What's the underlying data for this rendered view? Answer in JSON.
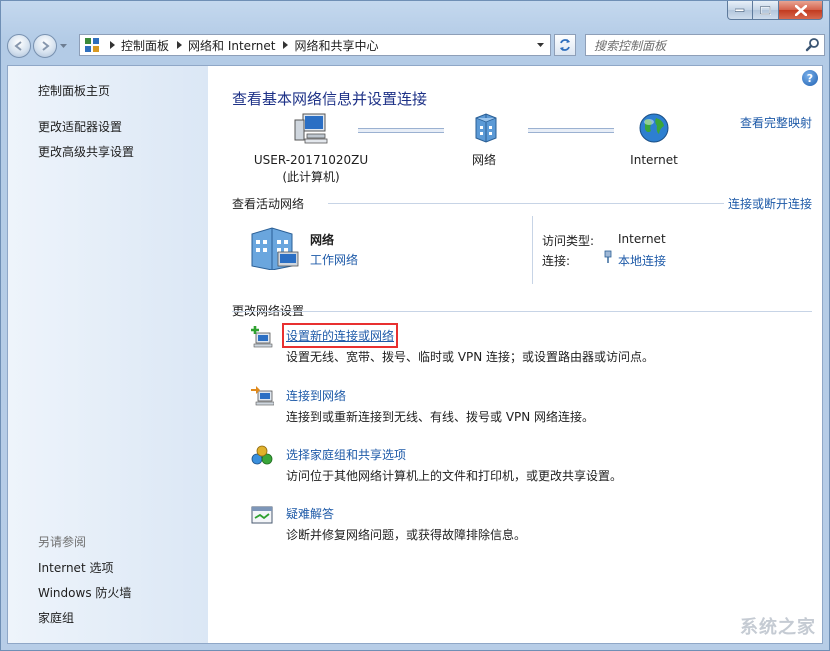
{
  "window": {
    "caption_buttons": [
      "minimize",
      "maximize",
      "close"
    ]
  },
  "navbar": {
    "breadcrumbs": [
      "控制面板",
      "网络和 Internet",
      "网络和共享中心"
    ],
    "search_placeholder": "搜索控制面板"
  },
  "sidebar": {
    "home": "控制面板主页",
    "items": [
      "更改适配器设置",
      "更改高级共享设置"
    ],
    "see_also_title": "另请参阅",
    "see_also": [
      "Internet 选项",
      "Windows 防火墙",
      "家庭组"
    ]
  },
  "main": {
    "title": "查看基本网络信息并设置连接",
    "full_map_link": "查看完整映射",
    "map": {
      "computer_name": "USER-20171020ZU",
      "computer_sub": "(此计算机)",
      "network": "网络",
      "internet": "Internet"
    },
    "active": {
      "heading": "查看活动网络",
      "connect_link": "连接或断开连接",
      "network_name": "网络",
      "network_type": "工作网络",
      "access_label": "访问类型:",
      "access_value": "Internet",
      "conn_label": "连接:",
      "conn_value": "本地连接"
    },
    "change": {
      "heading": "更改网络设置",
      "tasks": [
        {
          "link": "设置新的连接或网络",
          "desc": "设置无线、宽带、拨号、临时或 VPN 连接；或设置路由器或访问点。"
        },
        {
          "link": "连接到网络",
          "desc": "连接到或重新连接到无线、有线、拨号或 VPN 网络连接。"
        },
        {
          "link": "选择家庭组和共享选项",
          "desc": "访问位于其他网络计算机上的文件和打印机，或更改共享设置。"
        },
        {
          "link": "疑难解答",
          "desc": "诊断并修复网络问题，或获得故障排除信息。"
        }
      ]
    }
  },
  "watermark": "系统之家",
  "colors": {
    "link": "#1e5aa8",
    "title": "#1e3287",
    "highlight": "#e83030"
  }
}
